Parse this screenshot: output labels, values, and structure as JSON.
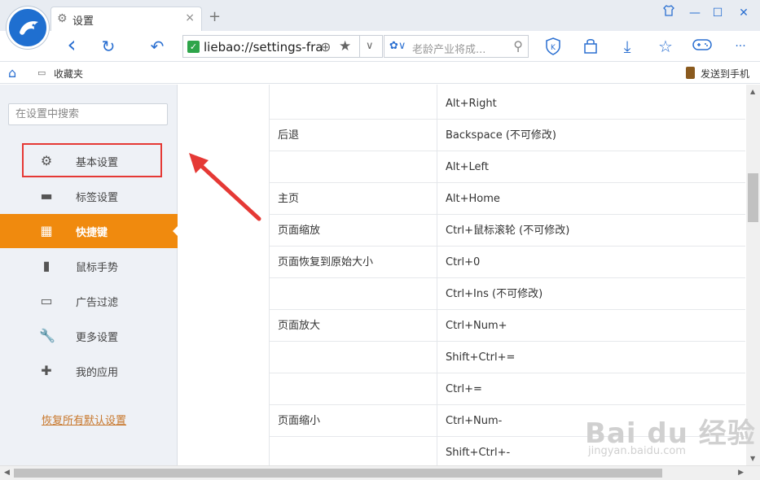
{
  "tab": {
    "title": "设置",
    "close": "×",
    "new_tab": "+"
  },
  "window": {
    "skin": "👕",
    "minimize": "—",
    "maximize": "☐",
    "close": "✕"
  },
  "nav": {
    "back": "‹",
    "refresh": "↻",
    "undo": "↶",
    "secure_mark": "✓",
    "url": "liebao://settings-frame/",
    "search_placeholder": "老龄产业将成...",
    "toolbar_icons": [
      "back-icon",
      "refresh-icon",
      "undo-icon",
      "shield-k-icon",
      "lock-icon",
      "download-icon",
      "star-icon",
      "gamepad-icon",
      "more-icon"
    ],
    "download": "⤓",
    "star": "☆",
    "gamepad": "🎮",
    "more": "···"
  },
  "bookmarks": {
    "home": "⌂",
    "favorites": "收藏夹",
    "send_to_phone": "发送到手机"
  },
  "sidebar": {
    "search_placeholder": "在设置中搜索",
    "items": [
      {
        "label": "基本设置",
        "icon": "gear-icon",
        "glyph": "⚙"
      },
      {
        "label": "标签设置",
        "icon": "tab-icon",
        "glyph": "▬"
      },
      {
        "label": "快捷键",
        "icon": "shortcut-grid-icon",
        "glyph": "▦"
      },
      {
        "label": "鼠标手势",
        "icon": "mouse-icon",
        "glyph": "▮"
      },
      {
        "label": "广告过滤",
        "icon": "window-icon",
        "glyph": "▭"
      },
      {
        "label": "更多设置",
        "icon": "wrench-icon",
        "glyph": "🔧"
      },
      {
        "label": "我的应用",
        "icon": "puzzle-icon",
        "glyph": "✚"
      }
    ],
    "active_index": 2,
    "restore_defaults": "恢复所有默认设置"
  },
  "shortcuts": {
    "rows": [
      {
        "action": "",
        "key": "Alt+Right"
      },
      {
        "action": "后退",
        "key": "Backspace (不可修改)"
      },
      {
        "action": "",
        "key": "Alt+Left"
      },
      {
        "action": "主页",
        "key": "Alt+Home"
      },
      {
        "action": "页面缩放",
        "key": "Ctrl+鼠标滚轮 (不可修改)"
      },
      {
        "action": "页面恢复到原始大小",
        "key": "Ctrl+0"
      },
      {
        "action": "",
        "key": "Ctrl+Ins (不可修改)"
      },
      {
        "action": "页面放大",
        "key": "Ctrl+Num+"
      },
      {
        "action": "",
        "key": "Shift+Ctrl+="
      },
      {
        "action": "",
        "key": "Ctrl+="
      },
      {
        "action": "页面缩小",
        "key": "Ctrl+Num-"
      },
      {
        "action": "",
        "key": "Shift+Ctrl+-"
      }
    ]
  },
  "watermark": {
    "brand": "Bai du 经验",
    "url": "jingyan.baidu.com"
  },
  "colors": {
    "accent": "#f08a0e",
    "brand_blue": "#2a6fd1",
    "highlight_red": "#e53935"
  }
}
